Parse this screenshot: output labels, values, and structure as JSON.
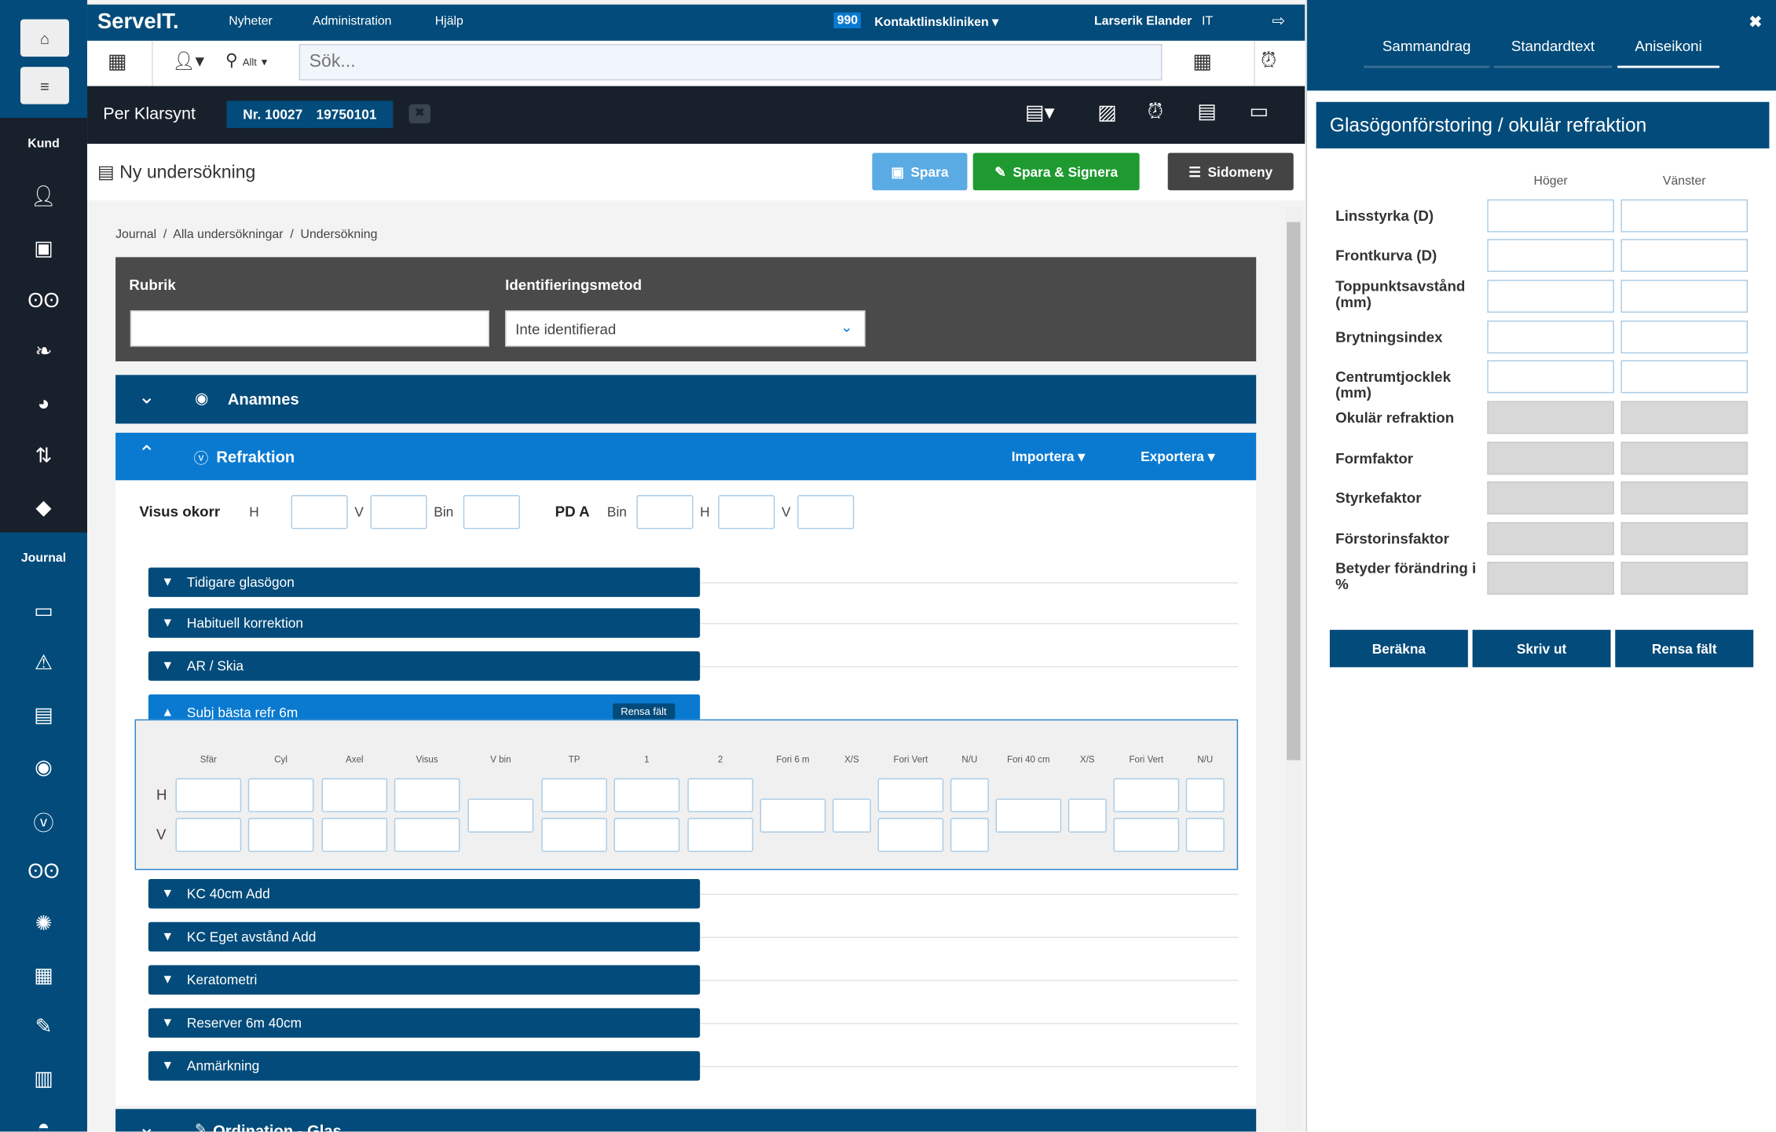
{
  "app": {
    "logo": "ServeIT.",
    "nav": [
      "Nyheter",
      "Administration",
      "Hjälp"
    ],
    "clinic_code": "990",
    "clinic": "Kontaktlinskliniken",
    "user": "Larserik Elander",
    "user_suffix": "IT"
  },
  "search": {
    "scope": "Allt",
    "placeholder": "Sök..."
  },
  "patient": {
    "name": "Per Klarsynt",
    "number": "Nr. 10027",
    "birth": "19750101"
  },
  "page": {
    "title": "Ny undersökning",
    "save": "Spara",
    "save_sign": "Spara & Signera",
    "side_menu": "Sidomeny"
  },
  "sidebar": {
    "kund": "Kund",
    "journal": "Journal"
  },
  "breadcrumb": [
    "Journal",
    "Alla undersökningar",
    "Undersökning"
  ],
  "form": {
    "rubrik_label": "Rubrik",
    "rubrik_value": "",
    "ident_label": "Identifieringsmetod",
    "ident_value": "Inte identifierad"
  },
  "sections": {
    "anamnes": "Anamnes",
    "refraktion": "Refraktion",
    "importera": "Importera",
    "exportera": "Exportera",
    "ordination": "Ordination - Glas"
  },
  "visus": {
    "label": "Visus okorr",
    "h": "H",
    "v": "V",
    "bin": "Bin",
    "pda": "PD A",
    "pda_bin": "Bin",
    "pda_h": "H",
    "pda_v": "V"
  },
  "subsections": [
    "Tidigare glasögon",
    "Habituell korrektion",
    "AR / Skia",
    "Subj bästa refr 6m",
    "KC 40cm Add",
    "KC Eget avstånd Add",
    "Keratometri",
    "Reserver 6m 40cm",
    "Anmärkning"
  ],
  "subj": {
    "clear": "Rensa fält",
    "columns": [
      "Sfär",
      "Cyl",
      "Axel",
      "Visus",
      "V bin",
      "TP",
      "1",
      "2",
      "Fori 6 m",
      "X/S",
      "Fori Vert",
      "N/U",
      "Fori 40 cm",
      "X/S",
      "Fori Vert",
      "N/U"
    ],
    "rows": [
      "H",
      "V"
    ]
  },
  "panel": {
    "tabs": [
      "Sammandrag",
      "Standardtext",
      "Aniseikoni"
    ],
    "active_tab": "Aniseikoni",
    "title": "Glasögonförstoring / okulär refraktion",
    "col_right": "Höger",
    "col_left": "Vänster",
    "rows": [
      "Linsstyrka (D)",
      "Frontkurva (D)",
      "Toppunktsavstånd (mm)",
      "Brytningsindex",
      "Centrumtjocklek (mm)",
      "Okulär refraktion",
      "Formfaktor",
      "Styrkefaktor",
      "Förstorinsfaktor",
      "Betyder förändring i %"
    ],
    "buttons": [
      "Beräkna",
      "Skriv ut",
      "Rensa fält"
    ]
  }
}
